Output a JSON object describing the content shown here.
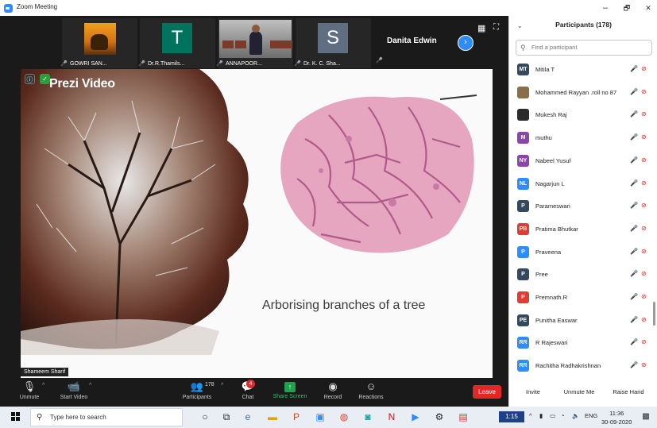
{
  "window": {
    "title": "Zoom Meeting",
    "minimize": "–",
    "maximize": "🗗",
    "close": "✕"
  },
  "thumbnails": [
    {
      "name": "GOWRI SAN..."
    },
    {
      "name": "Dr.R.Thamils...",
      "initial": "T"
    },
    {
      "name": "ANNAPOOR..."
    },
    {
      "name": "Dr. K. C. Sha...",
      "initial": "S"
    }
  ],
  "active_speaker_tile": {
    "name": "Danita Edwin"
  },
  "slide": {
    "brand": "Prezi Video",
    "caption": "Arborising branches of a tree",
    "speaker_label": "Shameem Sharif"
  },
  "toolbar": {
    "unmute": "Unmute",
    "start_video": "Start Video",
    "participants": "Participants",
    "participants_count": "178",
    "chat": "Chat",
    "chat_badge": "4",
    "share_screen": "Share Screen",
    "record": "Record",
    "reactions": "Reactions",
    "leave": "Leave"
  },
  "panel": {
    "title": "Participants (178)",
    "search_placeholder": "Find a participant",
    "participants": [
      {
        "initials": "MT",
        "name": "Mitila T",
        "color": "#34495e"
      },
      {
        "initials": "",
        "name": "Mohammed Rayyan .roll no 87",
        "color": "#8a6d4a"
      },
      {
        "initials": "",
        "name": "Mukesh Raj",
        "color": "#2b2b2b"
      },
      {
        "initials": "M",
        "name": "muthu",
        "color": "#8e44ad"
      },
      {
        "initials": "NY",
        "name": "Nabeel Yusuf",
        "color": "#8e44ad"
      },
      {
        "initials": "NL",
        "name": "Nagarjun L",
        "color": "#2d8cff"
      },
      {
        "initials": "P",
        "name": "Parameswari",
        "color": "#34495e"
      },
      {
        "initials": "PB",
        "name": "Pratima Bhutkar",
        "color": "#e03c31"
      },
      {
        "initials": "P",
        "name": "Praveena",
        "color": "#2d8cff"
      },
      {
        "initials": "P",
        "name": "Pree",
        "color": "#34495e"
      },
      {
        "initials": "P",
        "name": "Premnath.R",
        "color": "#e03c31"
      },
      {
        "initials": "PE",
        "name": "Punitha Easwar",
        "color": "#34495e"
      },
      {
        "initials": "RR",
        "name": "R Rajeswari",
        "color": "#2d8cff"
      },
      {
        "initials": "RR",
        "name": "Rachitha Radhakrishnan",
        "color": "#2d8cff"
      }
    ],
    "invite": "Invite",
    "unmute_me": "Unmute Me",
    "raise_hand": "Raise Hand"
  },
  "taskbar": {
    "search_placeholder": "Type here to search",
    "time_chip": "1:15",
    "lang": "ENG",
    "time": "11:36",
    "date": "30-09-2020"
  }
}
